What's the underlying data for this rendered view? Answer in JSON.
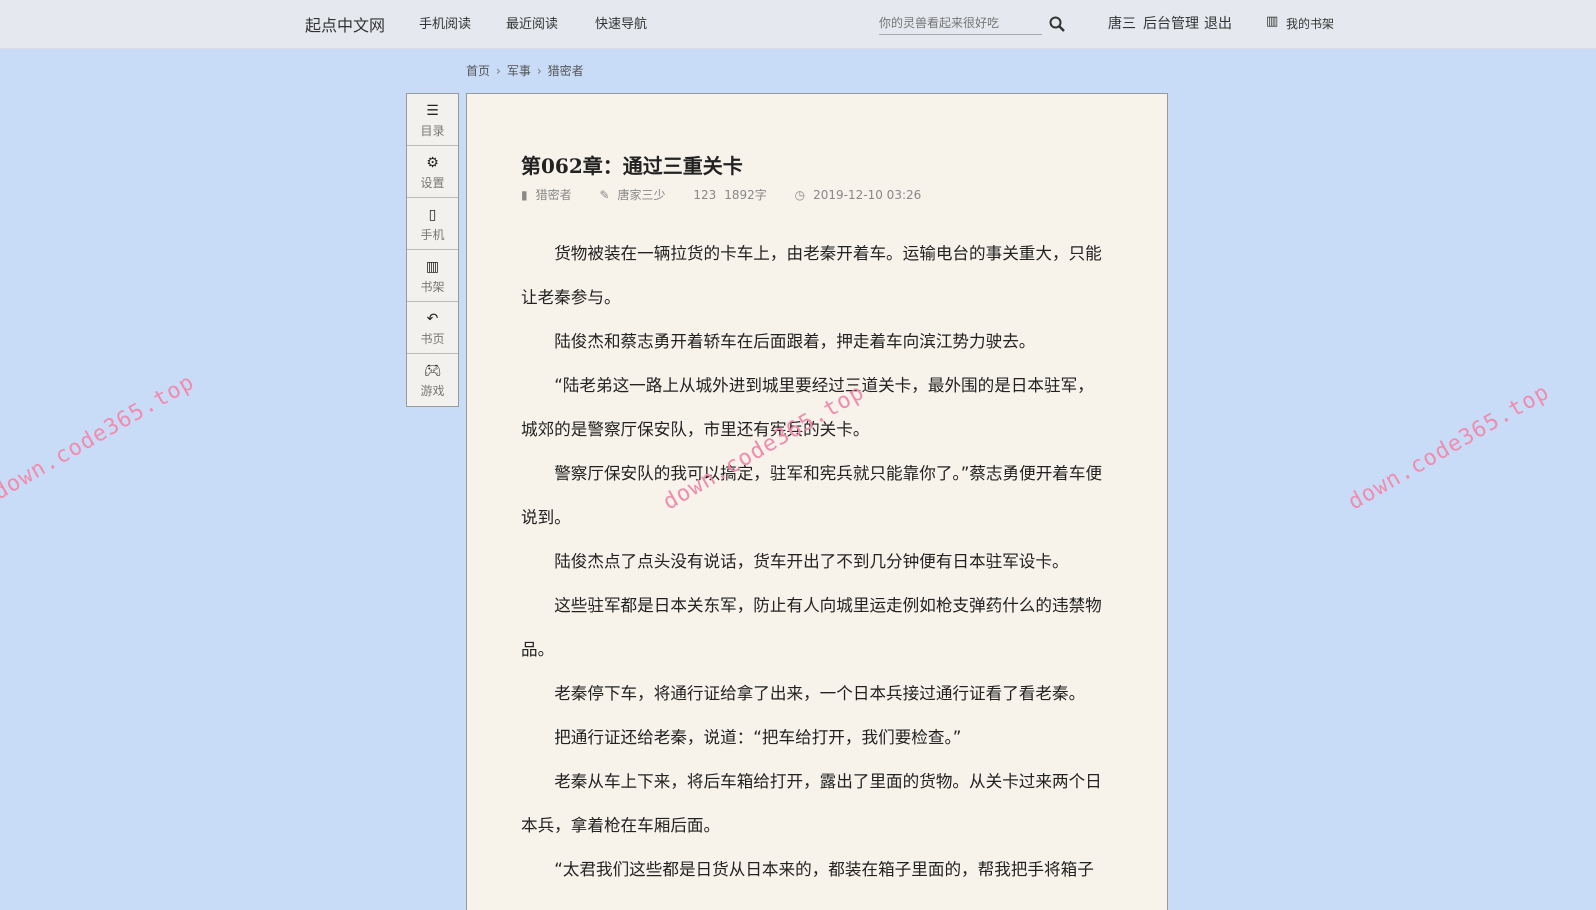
{
  "header": {
    "logo": "起点中文网",
    "nav": [
      "手机阅读",
      "最近阅读",
      "快速导航"
    ],
    "search_placeholder": "你的灵兽看起来很好吃",
    "user": "唐三",
    "admin": "后台管理",
    "logout": "退出",
    "bookshelf": "我的书架"
  },
  "breadcrumb": [
    "首页",
    "军事",
    "猎密者"
  ],
  "sidebar": [
    {
      "label": "目录",
      "icon": "list-icon"
    },
    {
      "label": "设置",
      "icon": "gear-icon"
    },
    {
      "label": "手机",
      "icon": "phone-icon"
    },
    {
      "label": "书架",
      "icon": "bookshelf-icon"
    },
    {
      "label": "书页",
      "icon": "back-icon"
    },
    {
      "label": "游戏",
      "icon": "gamepad-icon"
    }
  ],
  "chapter": {
    "title": "第062章：通过三重关卡",
    "book": "猎密者",
    "author": "唐家三少",
    "words": "1892字",
    "time": "2019-12-10 03:26",
    "paragraphs": [
      "货物被装在一辆拉货的卡车上，由老秦开着车。运输电台的事关重大，只能让老秦参与。",
      "陆俊杰和蔡志勇开着轿车在后面跟着，押走着车向滨江势力驶去。",
      "“陆老弟这一路上从城外进到城里要经过三道关卡，最外围的是日本驻军，城郊的是警察厅保安队，市里还有宪兵的关卡。",
      "警察厅保安队的我可以搞定，驻军和宪兵就只能靠你了。”蔡志勇便开着车便说到。",
      "陆俊杰点了点头没有说话，货车开出了不到几分钟便有日本驻军设卡。",
      "这些驻军都是日本关东军，防止有人向城里运走例如枪支弹药什么的违禁物品。",
      "老秦停下车，将通行证给拿了出来，一个日本兵接过通行证看了看老秦。",
      "把通行证还给老秦，说道：“把车给打开，我们要检查。”",
      "老秦从车上下来，将后车箱给打开，露出了里面的货物。从关卡过来两个日本兵，拿着枪在车厢后面。",
      "“太君我们这些都是日货从日本来的，都装在箱子里面的，帮我把手将箱子"
    ]
  },
  "watermark": "down.code365.top"
}
